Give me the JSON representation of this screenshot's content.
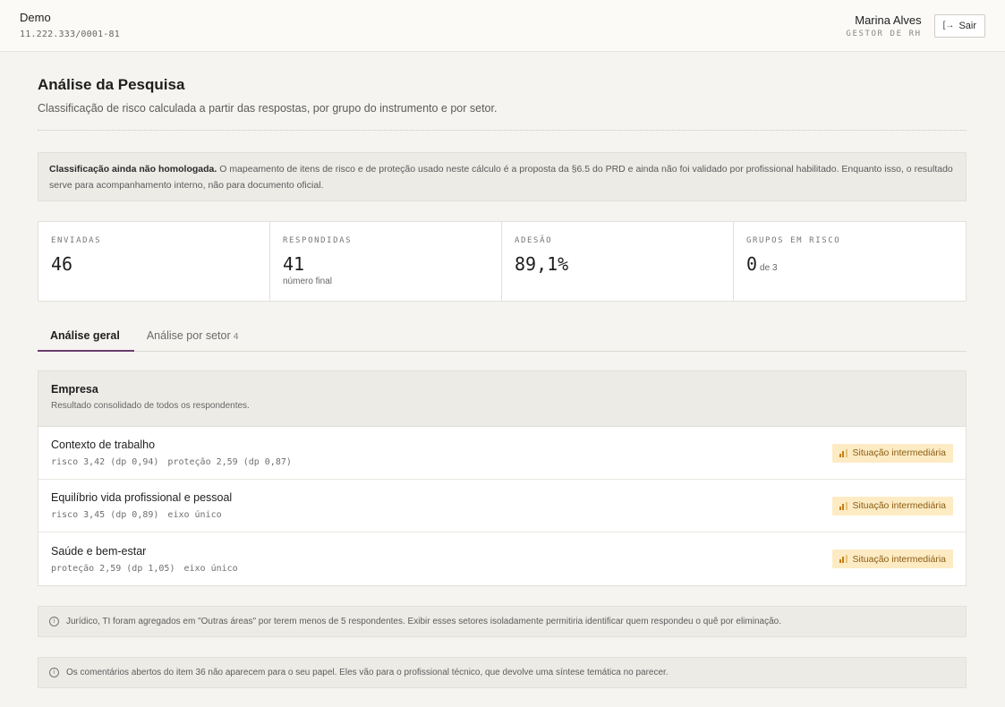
{
  "header": {
    "company_name": "Demo",
    "company_id": "11.222.333/0001-81",
    "user_name": "Marina Alves",
    "user_role": "GESTOR DE RH",
    "logout_label": "Sair",
    "logout_icon": "logout-icon"
  },
  "page": {
    "title": "Análise da Pesquisa",
    "subtitle": "Classificação de risco calculada a partir das respostas, por grupo do instrumento e por setor."
  },
  "notice": {
    "bold": "Classificação ainda não homologada.",
    "text": " O mapeamento de itens de risco e de proteção usado neste cálculo é a proposta da §6.5 do PRD e ainda não foi validado por profissional habilitado. Enquanto isso, o resultado serve para acompanhamento interno, não para documento oficial."
  },
  "stats": [
    {
      "label": "ENVIADAS",
      "value": "46",
      "note": "",
      "suffix": ""
    },
    {
      "label": "RESPONDIDAS",
      "value": "41",
      "note": "número final",
      "suffix": ""
    },
    {
      "label": "ADESÃO",
      "value": "89,1%",
      "note": "",
      "suffix": ""
    },
    {
      "label": "GRUPOS EM RISCO",
      "value": "0",
      "note": "",
      "suffix": "de 3"
    }
  ],
  "tabs": [
    {
      "label": "Análise geral",
      "count": ""
    },
    {
      "label": "Análise por setor",
      "count": "4"
    }
  ],
  "panel": {
    "title": "Empresa",
    "description": "Resultado consolidado de todos os respondentes.",
    "groups": [
      {
        "name": "Contexto de trabalho",
        "stat1": "risco 3,42 (dp 0,94)",
        "stat2": "proteção 2,59 (dp 0,87)",
        "badge": "Situação intermediária"
      },
      {
        "name": "Equilíbrio vida profissional e pessoal",
        "stat1": "risco 3,45 (dp 0,89)",
        "stat2": "eixo único",
        "badge": "Situação intermediária"
      },
      {
        "name": "Saúde e bem-estar",
        "stat1": "proteção 2,59 (dp 1,05)",
        "stat2": "eixo único",
        "badge": "Situação intermediária"
      }
    ]
  },
  "info": [
    "Jurídico, TI foram agregados em \"Outras áreas\" por terem menos de 5 respondentes. Exibir esses setores isoladamente permitiria identificar quem respondeu o quê por eliminação.",
    "Os comentários abertos do item 36 não aparecem para o seu papel. Eles vão para o profissional técnico, que devolve uma síntese temática no parecer."
  ],
  "colors": {
    "accent": "#6a3c6e",
    "badge_bg": "#fdebc4",
    "badge_text": "#8a5d13"
  }
}
